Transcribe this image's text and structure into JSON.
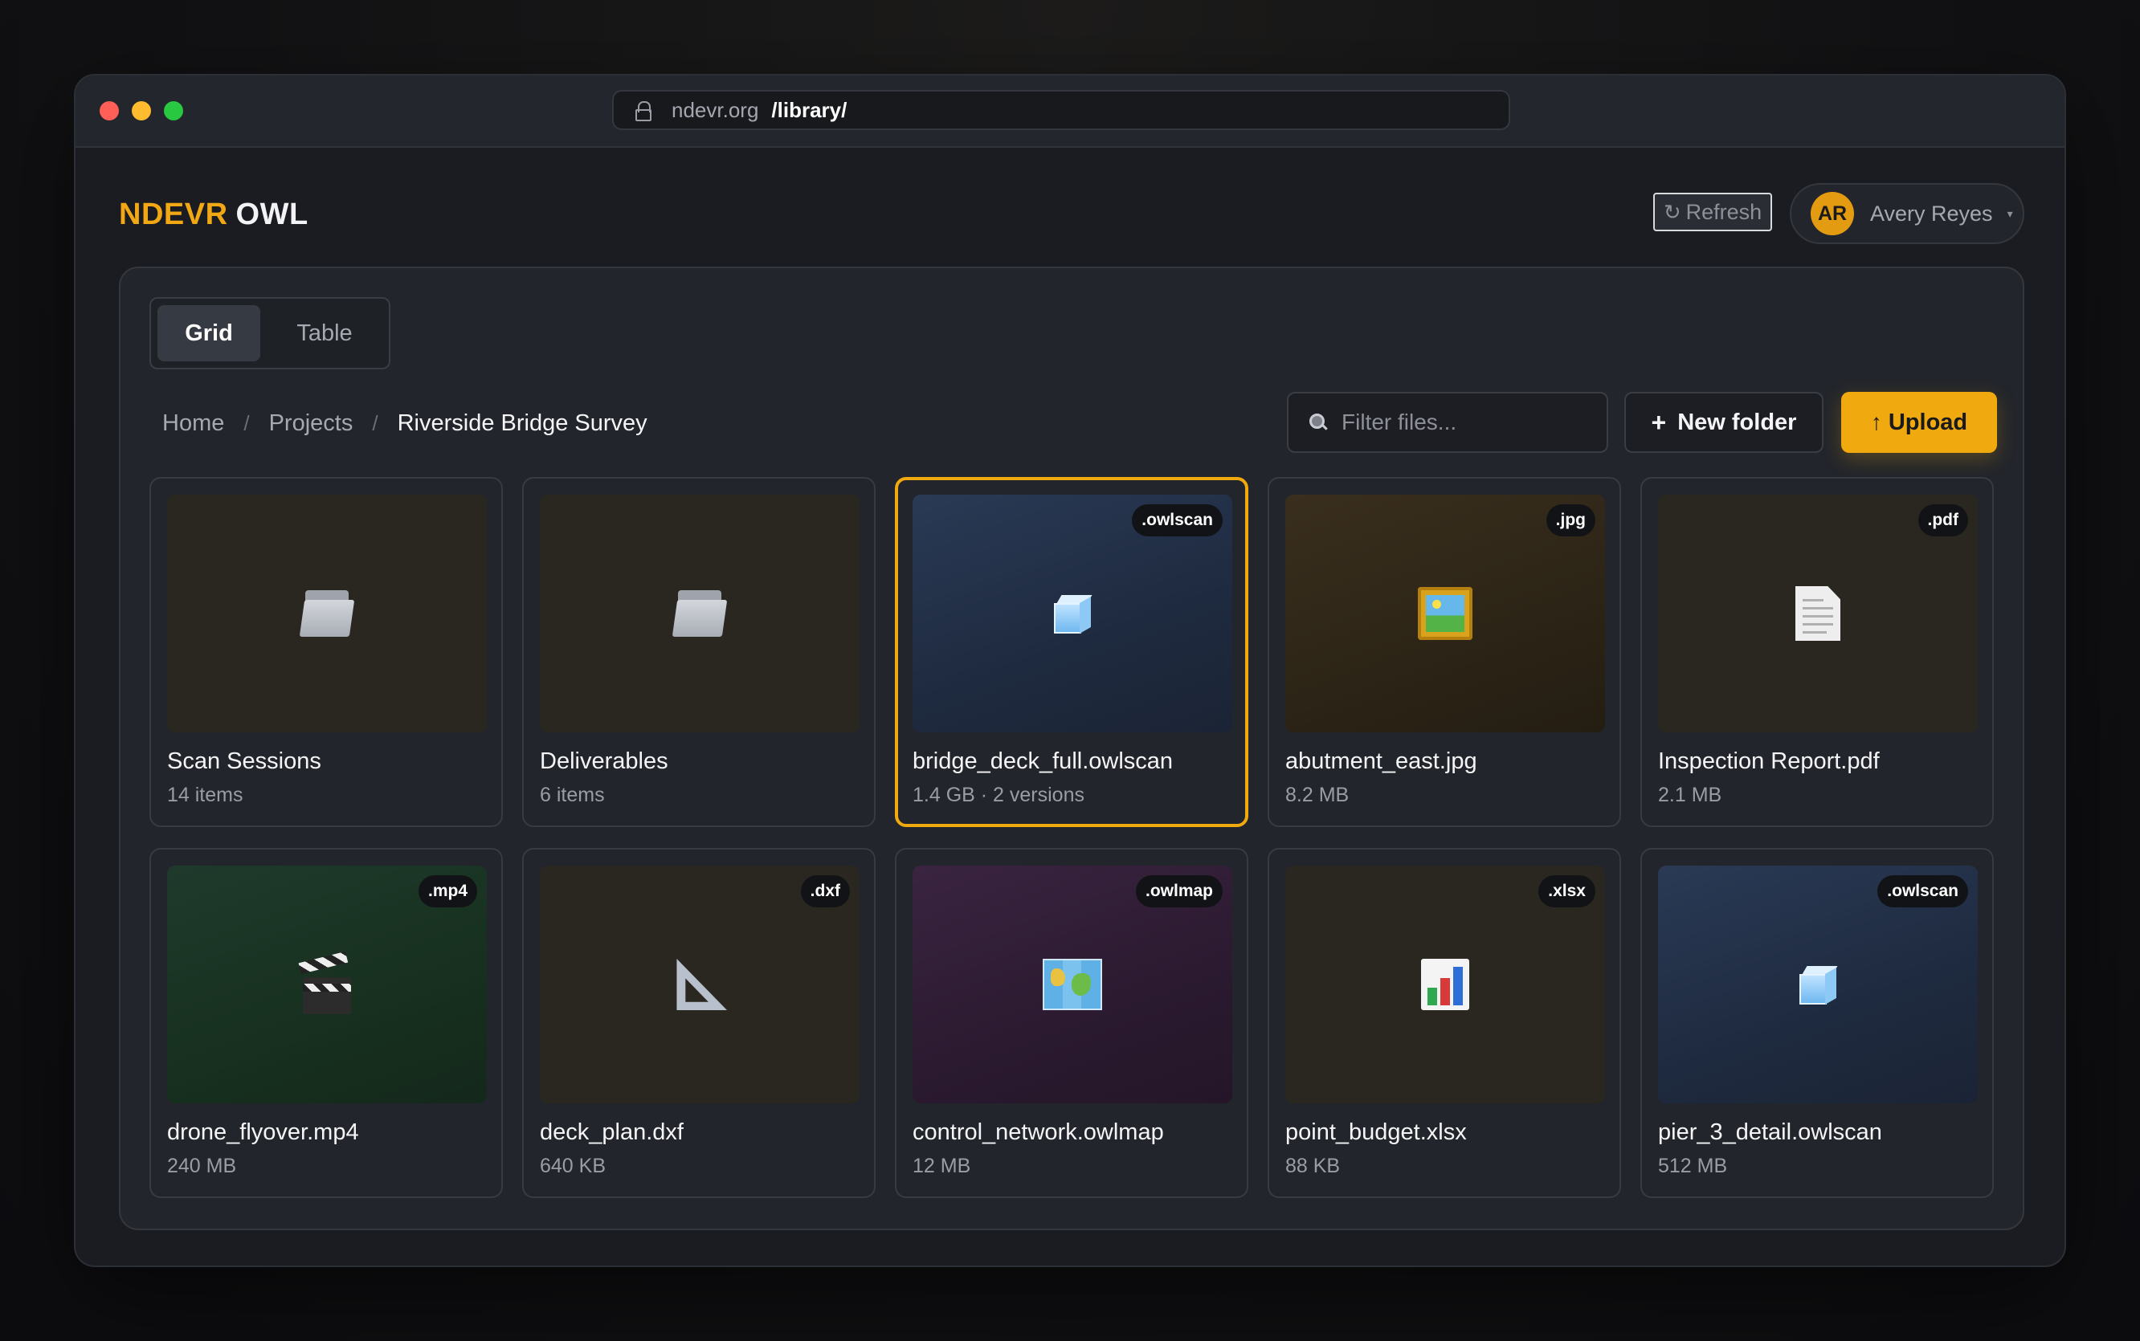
{
  "browser": {
    "url_host": "ndevr.org",
    "url_path": "/library/"
  },
  "app": {
    "brand_primary": "NDEVR",
    "brand_secondary": "OWL",
    "accent_color": "#f0a90f"
  },
  "header": {
    "refresh_label": "Refresh",
    "user": {
      "initials": "AR",
      "name": "Avery Reyes"
    }
  },
  "view_toggle": {
    "grid_label": "Grid",
    "table_label": "Table",
    "active": "Grid"
  },
  "breadcrumb": {
    "items": [
      "Home",
      "Projects"
    ],
    "separator": "/",
    "current": "Riverside Bridge Survey"
  },
  "toolbar": {
    "filter_placeholder": "Filter files...",
    "new_folder_label": "New folder",
    "upload_label": "Upload"
  },
  "items": [
    {
      "name": "Scan Sessions",
      "meta": "14 items",
      "ext": "",
      "icon": "folder-icon",
      "kind": "folder",
      "selected": false
    },
    {
      "name": "Deliverables",
      "meta": "6 items",
      "ext": "",
      "icon": "folder-icon",
      "kind": "folder",
      "selected": false
    },
    {
      "name": "bridge_deck_full.owlscan",
      "meta": "1.4 GB · 2 versions",
      "ext": ".owlscan",
      "icon": "ice-cube-icon",
      "kind": "scan",
      "selected": true
    },
    {
      "name": "abutment_east.jpg",
      "meta": "8.2 MB",
      "ext": ".jpg",
      "icon": "framed-picture-icon",
      "kind": "image",
      "selected": false
    },
    {
      "name": "Inspection Report.pdf",
      "meta": "2.1 MB",
      "ext": ".pdf",
      "icon": "document-icon",
      "kind": "doc",
      "selected": false
    },
    {
      "name": "drone_flyover.mp4",
      "meta": "240 MB",
      "ext": ".mp4",
      "icon": "clapper-board-icon",
      "kind": "video",
      "selected": false
    },
    {
      "name": "deck_plan.dxf",
      "meta": "640 KB",
      "ext": ".dxf",
      "icon": "triangular-ruler-icon",
      "kind": "cad",
      "selected": false
    },
    {
      "name": "control_network.owlmap",
      "meta": "12 MB",
      "ext": ".owlmap",
      "icon": "world-map-icon",
      "kind": "map",
      "selected": false
    },
    {
      "name": "point_budget.xlsx",
      "meta": "88 KB",
      "ext": ".xlsx",
      "icon": "bar-chart-icon",
      "kind": "sheet",
      "selected": false
    },
    {
      "name": "pier_3_detail.owlscan",
      "meta": "512 MB",
      "ext": ".owlscan",
      "icon": "ice-cube-icon",
      "kind": "scan",
      "selected": false
    }
  ]
}
